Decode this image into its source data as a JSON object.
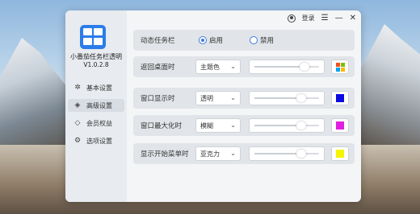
{
  "app": {
    "name": "小番茄任务栏透明",
    "version": "V1.0.2.8"
  },
  "topbar": {
    "login_label": "登录",
    "menu_glyph": "☰",
    "minimize_glyph": "—",
    "close_glyph": "✕"
  },
  "sidebar": {
    "items": [
      {
        "label": "基本设置",
        "icon": "sparkle-icon",
        "glyph": "✲",
        "active": false
      },
      {
        "label": "高级设置",
        "icon": "layers-icon",
        "glyph": "◈",
        "active": true
      },
      {
        "label": "会员权益",
        "icon": "diamond-icon",
        "glyph": "◇",
        "active": false
      },
      {
        "label": "选项设置",
        "icon": "settings-icon",
        "glyph": "⚙",
        "active": false
      }
    ]
  },
  "dynamic_taskbar": {
    "label": "动态任务栏",
    "options": [
      "启用",
      "禁用"
    ],
    "selected": "启用"
  },
  "rows": [
    {
      "label": "返回桌面时",
      "select": "主题色",
      "slider": 0.78,
      "color": "windows-logo",
      "swatch_type": "windows"
    },
    {
      "label": "窗口显示时",
      "select": "透明",
      "slider": 0.72,
      "color": "#0b0be0",
      "swatch_type": "color"
    },
    {
      "label": "窗口最大化时",
      "select": "模糊",
      "slider": 0.72,
      "color": "#e020e0",
      "swatch_type": "color"
    },
    {
      "label": "显示开始菜单时",
      "select": "亚克力",
      "slider": 0.72,
      "color": "#f5f500",
      "swatch_type": "color"
    }
  ],
  "colors": {
    "accent": "#2b7de9",
    "radio": "#3d7be0"
  }
}
